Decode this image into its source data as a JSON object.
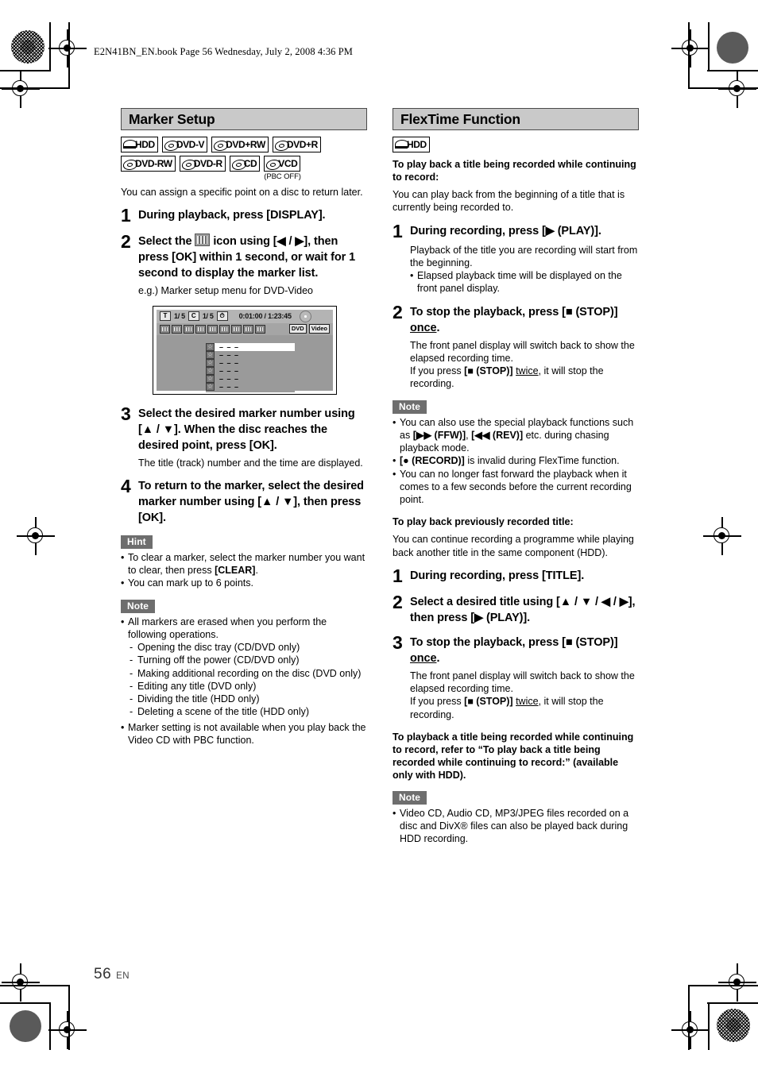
{
  "header": {
    "filestamp": "E2N41BN_EN.book  Page 56  Wednesday, July 2, 2008  4:36 PM"
  },
  "footer": {
    "page_number": "56",
    "language_code": "EN"
  },
  "left_column": {
    "section_title": "Marker Setup",
    "media_badges": [
      {
        "label": "HDD",
        "type": "hdd",
        "note": ""
      },
      {
        "label": "DVD-V",
        "type": "disc",
        "note": ""
      },
      {
        "label": "DVD+RW",
        "type": "disc",
        "note": ""
      },
      {
        "label": "DVD+R",
        "type": "disc",
        "note": ""
      },
      {
        "label": "DVD-RW",
        "type": "disc",
        "note": ""
      },
      {
        "label": "DVD-R",
        "type": "disc",
        "note": ""
      },
      {
        "label": "CD",
        "type": "disc",
        "note": ""
      },
      {
        "label": "VCD",
        "type": "disc",
        "note": "(PBC OFF)"
      }
    ],
    "intro": "You can assign a specific point on a disc to return later.",
    "steps": [
      {
        "number": "1",
        "text": "During playback, press [DISPLAY].",
        "sub": ""
      },
      {
        "number": "2",
        "text_before_icon": "Select the ",
        "text_after_icon": " icon using [◀ / ▶], then press [OK] within 1 second, or wait for 1 second to display the marker list.",
        "sub": "e.g.) Marker setup menu for DVD-Video"
      },
      {
        "number": "3",
        "text": "Select the desired marker number using [▲ / ▼]. When the disc reaches the desired point, press [OK].",
        "sub": "The title (track) number and the time are displayed."
      },
      {
        "number": "4",
        "text": "To return to the marker, select the desired marker number using [▲ / ▼], then press [OK].",
        "sub": ""
      }
    ],
    "osd": {
      "title_chip": "T",
      "title_value": "1/  5",
      "chapter_chip": "C",
      "chapter_value": "1/  5",
      "clock_chip": "⏱",
      "time": "0:01:00 / 1:23:45",
      "format_chips": [
        "DVD",
        "Video"
      ],
      "marker_rows": [
        {
          "star": "☆",
          "dashes": "– – –",
          "selected": true
        },
        {
          "star": "☆",
          "dashes": "– – –",
          "selected": false
        },
        {
          "star": "☆",
          "dashes": "– – –",
          "selected": false
        },
        {
          "star": "☆",
          "dashes": "– – –",
          "selected": false
        },
        {
          "star": "☆",
          "dashes": "– – –",
          "selected": false
        },
        {
          "star": "☆",
          "dashes": "– – –",
          "selected": false
        }
      ]
    },
    "hint": {
      "label": "Hint",
      "items": [
        "To clear a marker, select the marker number you want to clear, then press [CLEAR].",
        "You can mark up to 6 points."
      ]
    },
    "note": {
      "label": "Note",
      "items": [
        "All markers are erased when you perform the following operations.",
        "Marker setting is not available when you play back the Video CD with PBC function."
      ],
      "sublist": [
        "Opening the disc tray (CD/DVD only)",
        "Turning off the power (CD/DVD only)",
        "Making additional recording on the disc (DVD only)",
        "Editing any title (DVD only)",
        "Dividing the title (HDD only)",
        "Deleting a scene of the title (HDD only)"
      ]
    }
  },
  "right_column": {
    "section_title": "FlexTime Function",
    "media_badges": [
      {
        "label": "HDD",
        "type": "hdd",
        "note": ""
      }
    ],
    "sub_heading_1": "To play back a title being recorded while continuing to record:",
    "intro_1": "You can play back from the beginning of a title that is currently being recorded to.",
    "steps_1": [
      {
        "number": "1",
        "text": "During recording, press [▶ (PLAY)].",
        "sub": "Playback of the title you are recording will start from the beginning.",
        "sub_bullet": "Elapsed playback time will be displayed on the front panel display."
      },
      {
        "number": "2",
        "text_a": "To stop the playback, press [■ (STOP)] ",
        "text_underline": "once",
        "text_b": ".",
        "sub_1": "The front panel display will switch back to show the elapsed recording time.",
        "sub_2_a": "If you press [■ (STOP)] ",
        "sub_2_underline": "twice",
        "sub_2_b": ", it will stop the recording."
      }
    ],
    "note_1": {
      "label": "Note",
      "items": [
        "You can also use the special playback functions such as [▶▶ (FFW)], [◀◀ (REV)] etc. during chasing playback mode.",
        "[● (RECORD)] is invalid during FlexTime function.",
        "You can no longer fast forward the playback when it comes to a few seconds before the current recording point."
      ]
    },
    "sub_heading_2": "To play back previously recorded title:",
    "intro_2": "You can continue recording a programme while playing back another title in the same component (HDD).",
    "steps_2": [
      {
        "number": "1",
        "text": "During recording, press [TITLE]."
      },
      {
        "number": "2",
        "text": "Select a desired title using [▲ / ▼ / ◀ / ▶], then press [▶ (PLAY)]."
      },
      {
        "number": "3",
        "text_a": "To stop the playback, press [■ (STOP)] ",
        "text_underline": "once",
        "text_b": ".",
        "sub_1": "The front panel display will switch back to show the elapsed recording time.",
        "sub_2_a": "If you press [■ (STOP)] ",
        "sub_2_underline": "twice",
        "sub_2_b": ", it will stop the recording."
      }
    ],
    "sub_heading_3": "To playback a title being recorded while continuing to record, refer to “To play back a title being recorded while continuing to record:” (available only with HDD).",
    "note_2": {
      "label": "Note",
      "items": [
        "Video CD, Audio CD, MP3/JPEG files recorded on a disc and DivX® files can also be played back during HDD recording."
      ]
    }
  },
  "colors": {
    "section_title_bg": "#c9c9c9",
    "tag_bg": "#6e6e6e",
    "osd_bg": "#9a9a9a"
  }
}
